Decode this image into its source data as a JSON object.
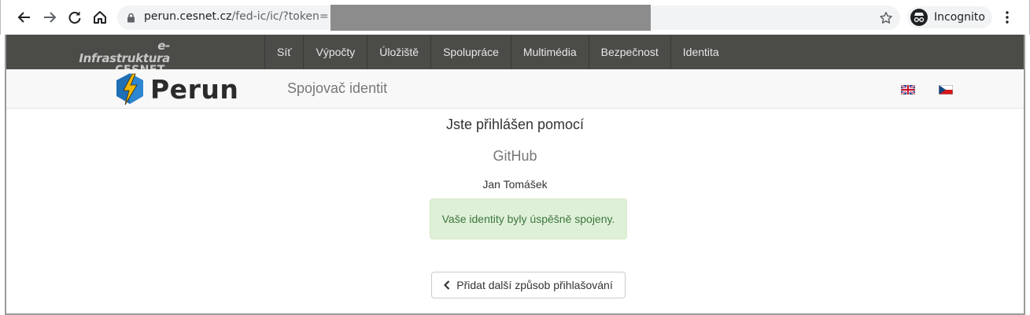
{
  "browser": {
    "url_host": "perun.cesnet.cz",
    "url_path": "/fed-ic/ic/?token=",
    "profile_label": "Incognito"
  },
  "brand": {
    "line1": "e-Infrastruktura",
    "line2": "CESNET"
  },
  "topnav": {
    "items": [
      {
        "label": "Síť"
      },
      {
        "label": "Výpočty"
      },
      {
        "label": "Úložiště"
      },
      {
        "label": "Spolupráce"
      },
      {
        "label": "Multimédia"
      },
      {
        "label": "Bezpečnost"
      },
      {
        "label": "Identita"
      }
    ]
  },
  "header": {
    "logo_text": "Perun",
    "subtitle": "Spojovač identit"
  },
  "main": {
    "heading": "Jste přihlášen pomocí",
    "provider": "GitHub",
    "user_name": "Jan Tomášek",
    "success_message": "Vaše identity byly úspěšně spojeny.",
    "add_button_label": "Přidat další způsob přihlašování"
  },
  "colors": {
    "topnav_bg": "#4b4b48",
    "alert_bg": "#dff0d8",
    "alert_text": "#3c763d",
    "logo_blue": "#1f6fb5",
    "logo_bolt": "#f2b705"
  },
  "icons": [
    "back-arrow-icon",
    "forward-arrow-icon",
    "reload-icon",
    "home-icon",
    "lock-icon",
    "star-icon",
    "incognito-icon",
    "more-vert-icon",
    "perun-logo-icon",
    "flag-uk-icon",
    "flag-cz-icon",
    "chevron-left-icon"
  ]
}
